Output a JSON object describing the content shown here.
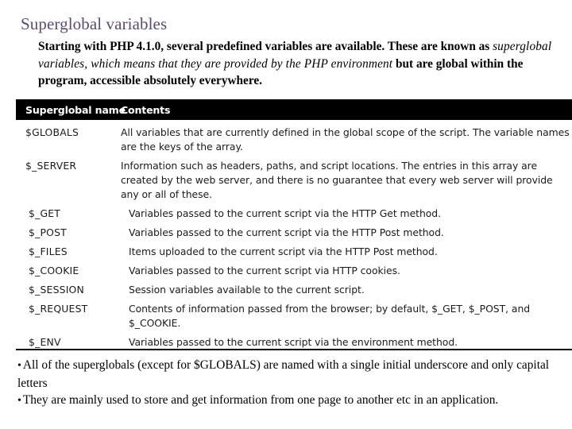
{
  "slide": {
    "title": "Superglobal variables"
  },
  "intro": {
    "part1": "Starting with PHP 4.1.0, several predefined variables are available. These are known as ",
    "italic": "superglobal variables, which means that they are provided by the PHP environment",
    "part2": " but are global within the program, accessible absolutely everywhere."
  },
  "table": {
    "headers": {
      "name": "Superglobal name",
      "contents": "Contents"
    },
    "rows": [
      {
        "name": "$GLOBALS",
        "desc": "All variables that are currently defined in the global scope of the script. The variable names are the keys of the array."
      },
      {
        "name": "$_SERVER",
        "desc": "Information such as headers, paths, and script locations. The entries in this array are created by the web server, and there is no guarantee that every web server will provide any or all of these."
      },
      {
        "name": "$_GET",
        "desc": "Variables passed to the current script via the HTTP Get method."
      },
      {
        "name": "$_POST",
        "desc": "Variables passed to the current script via the HTTP Post method."
      },
      {
        "name": "$_FILES",
        "desc": "Items uploaded to the current script via the HTTP Post method."
      },
      {
        "name": "$_COOKIE",
        "desc": "Variables passed to the current script via HTTP cookies."
      },
      {
        "name": "$_SESSION",
        "desc": "Session variables available to the current script."
      },
      {
        "name": "$_REQUEST",
        "desc": "Contents of information passed from the browser; by default, $_GET, $_POST, and $_COOKIE."
      },
      {
        "name": "$_ENV",
        "desc": "Variables passed to the current script via the environment method."
      }
    ]
  },
  "bullets": {
    "mark": "•",
    "items": [
      "All of the superglobals (except for $GLOBALS) are named with a single initial underscore and only capital letters",
      "They are mainly used to store and get information from one page to another etc in an application."
    ]
  },
  "colors": {
    "title": "#5a4a78",
    "header_bar": "#000000",
    "text": "#000000",
    "background": "#ffffff"
  }
}
